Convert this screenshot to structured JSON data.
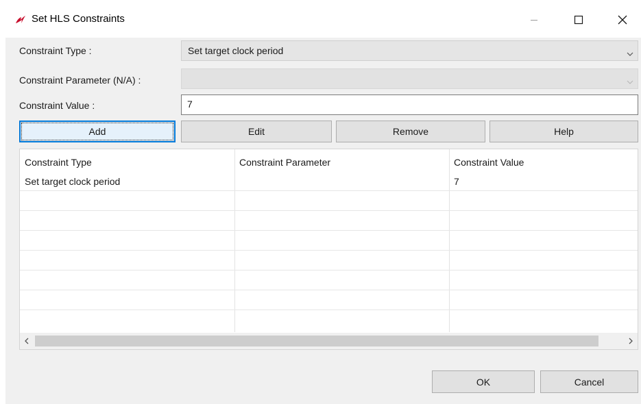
{
  "window": {
    "title": "Set HLS Constraints"
  },
  "form": {
    "constraint_type_label": "Constraint Type :",
    "constraint_type_value": "Set target clock period",
    "constraint_param_label": "Constraint Parameter (N/A) :",
    "constraint_param_value": "",
    "constraint_value_label": "Constraint Value :",
    "constraint_value": "7"
  },
  "buttons": {
    "add": "Add",
    "edit": "Edit",
    "remove": "Remove",
    "help": "Help",
    "ok": "OK",
    "cancel": "Cancel"
  },
  "table": {
    "headers": [
      "Constraint Type",
      "Constraint Parameter",
      "Constraint Value"
    ],
    "rows": [
      [
        "Set target clock period",
        "",
        "7"
      ]
    ]
  },
  "colors": {
    "accent": "#0078d7",
    "app_icon": "#c8102e"
  },
  "icons": {
    "app": "xilinx-logo-icon",
    "minimize": "minimize-icon",
    "maximize": "maximize-icon",
    "close": "close-icon",
    "dropdown": "chevron-down-icon",
    "scroll_left": "scroll-left-arrow-icon",
    "scroll_right": "scroll-right-arrow-icon"
  }
}
